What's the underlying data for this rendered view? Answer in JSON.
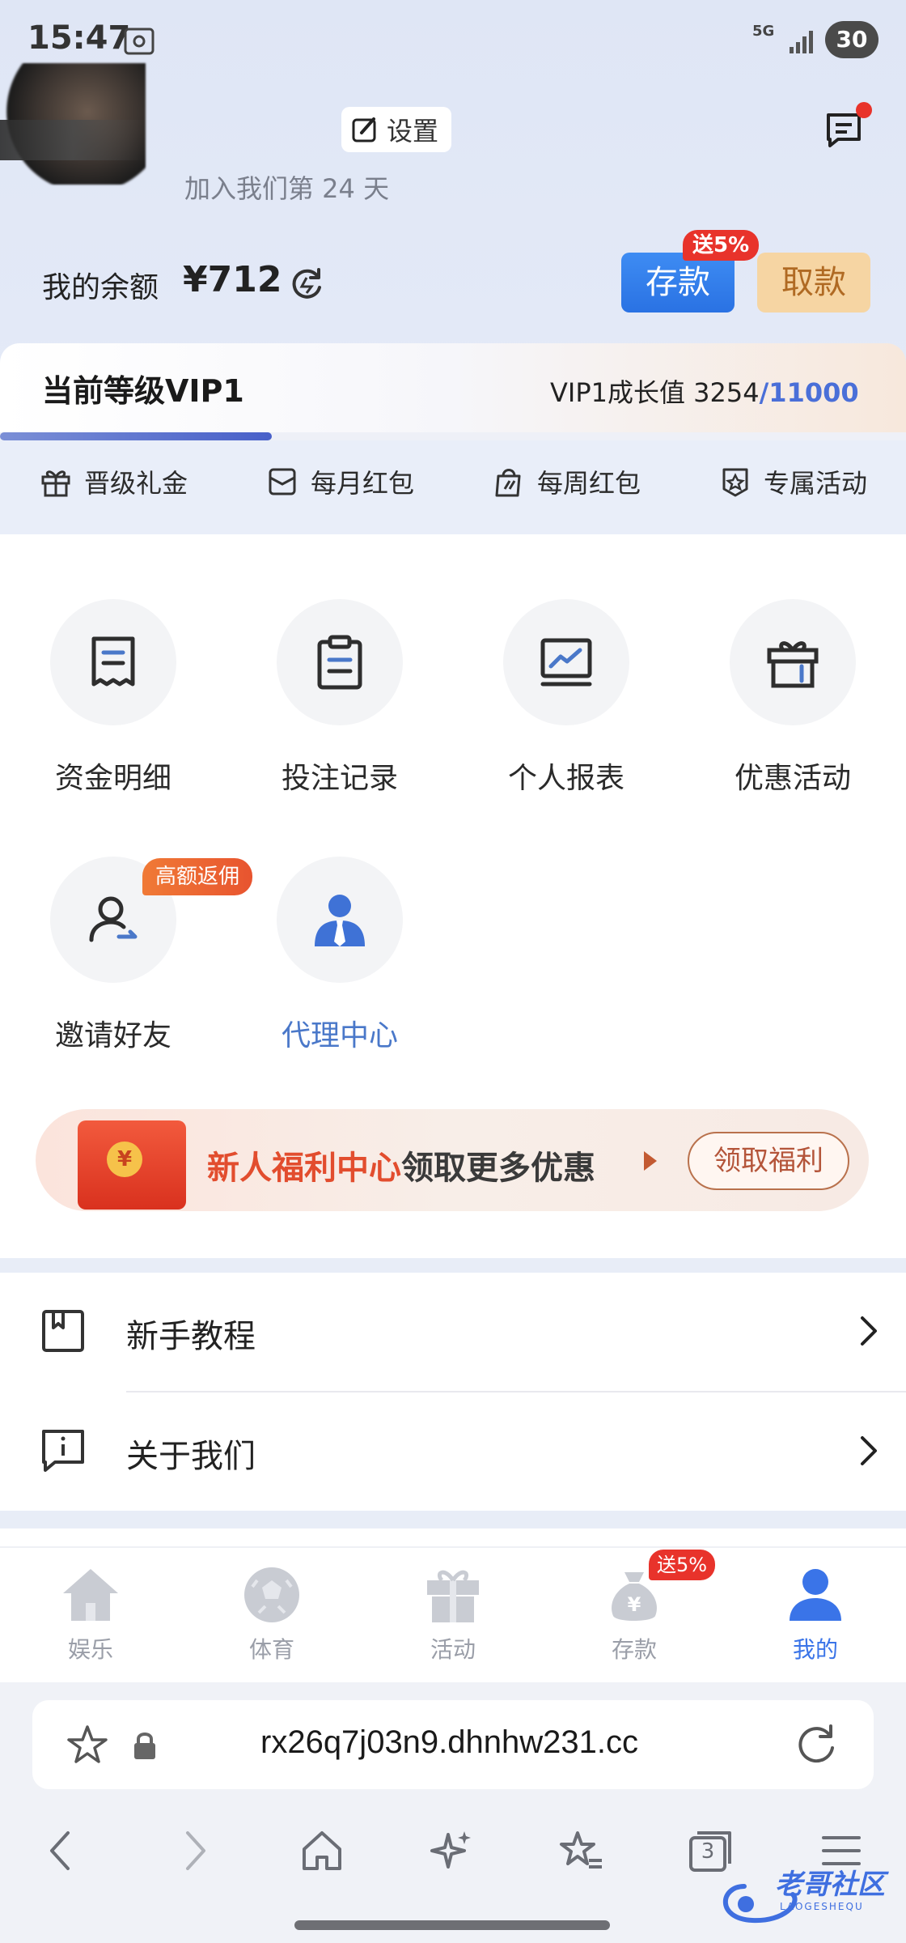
{
  "status_bar": {
    "time": "15:47",
    "network": "5G",
    "battery": "30"
  },
  "profile": {
    "settings_label": "设置",
    "join_text": "加入我们第 24 天"
  },
  "balance": {
    "label": "我的余额",
    "value": "¥712",
    "deposit_label": "存款",
    "deposit_badge": "送5%",
    "withdraw_label": "取款"
  },
  "vip": {
    "level_label": "当前等级VIP1",
    "growth_label": "VIP1成长值",
    "growth_current": "3254",
    "growth_max": "/11000",
    "progress": 0.3,
    "benefits": [
      {
        "label": "晋级礼金",
        "icon": "gift-icon"
      },
      {
        "label": "每月红包",
        "icon": "envelope-icon"
      },
      {
        "label": "每周红包",
        "icon": "shopping-bag-icon"
      },
      {
        "label": "专属活动",
        "icon": "badge-icon"
      }
    ]
  },
  "grid": [
    {
      "label": "资金明细",
      "icon": "receipt-icon"
    },
    {
      "label": "投注记录",
      "icon": "clipboard-icon"
    },
    {
      "label": "个人报表",
      "icon": "chart-monitor-icon"
    },
    {
      "label": "优惠活动",
      "icon": "gift-box-icon"
    },
    {
      "label": "邀请好友",
      "icon": "invite-user-icon",
      "badge": "高额返佣"
    },
    {
      "label": "代理中心",
      "icon": "agent-icon"
    }
  ],
  "welfare": {
    "title_red": "新人福利中心",
    "title_dark": "领取更多优惠",
    "coin": "¥",
    "button_label": "领取福利"
  },
  "list": [
    {
      "label": "新手教程",
      "icon": "book-icon"
    },
    {
      "label": "关于我们",
      "icon": "info-icon"
    }
  ],
  "tab_bar": {
    "items": [
      {
        "label": "娱乐",
        "icon": "home-icon"
      },
      {
        "label": "体育",
        "icon": "soccer-ball-icon"
      },
      {
        "label": "活动",
        "icon": "gift-icon"
      },
      {
        "label": "存款",
        "icon": "money-bag-icon",
        "badge": "送5%"
      },
      {
        "label": "我的",
        "icon": "user-icon"
      }
    ],
    "active_index": 4
  },
  "browser": {
    "url": "rx26q7j03n9.dhnhw231.cc",
    "tab_count": "3"
  },
  "watermark": {
    "text": "老哥社区",
    "sub": "LAOGESHEQU"
  },
  "colors": {
    "accent": "#3a74e8",
    "red": "#e8332b",
    "withdraw_bg": "#f6d5a3",
    "welfare_red": "#e24d2e"
  }
}
